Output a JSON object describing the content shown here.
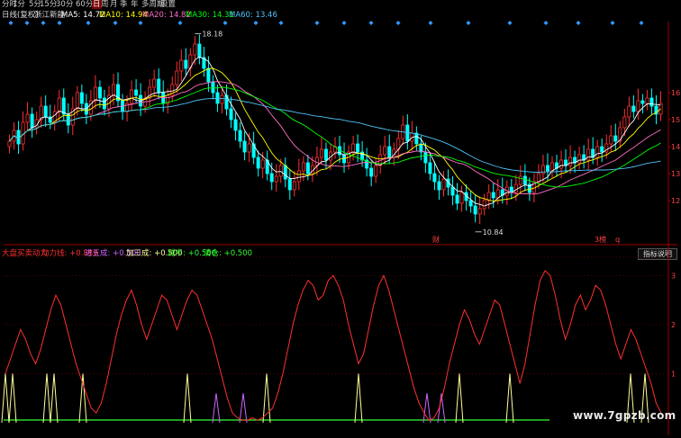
{
  "toolbar": {
    "items": [
      "分时",
      "1分",
      "5分",
      "15分",
      "30分",
      "60分",
      "日",
      "周",
      "月",
      "季",
      "年",
      "多周期",
      "设置"
    ],
    "active": "日"
  },
  "main_legend": {
    "period": "日线(复权)",
    "stock": "浙江新能",
    "ma": [
      {
        "label": "MA5:",
        "value": "14.72",
        "color": "#ffffff"
      },
      {
        "label": "MA10:",
        "value": "14.94",
        "color": "#ffff00"
      },
      {
        "label": "MA20:",
        "value": "14.82",
        "color": "#ff6ec7"
      },
      {
        "label": "MA30:",
        "value": "14.31",
        "color": "#00ff00"
      },
      {
        "label": "MA60:",
        "value": "13.46",
        "color": "#4fc3f7"
      }
    ]
  },
  "annotations": {
    "high": "18.18",
    "low": "10.84",
    "marker_cai": "财",
    "marker_right": "3榜",
    "marker_q": "q"
  },
  "ind_legend": {
    "items": [
      {
        "text": "大盘买卖动力",
        "color": "#ff3030"
      },
      {
        "text": "动力线: +0.889",
        "color": "#ff3030"
      },
      {
        "text": "进五成: +0.500",
        "color": "#cc66ff"
      },
      {
        "text": "加三成: +0.500",
        "color": "#ffff99"
      },
      {
        "text": "减半: +0.500",
        "color": "#33ff33"
      },
      {
        "text": "清仓: +0.500",
        "color": "#33ff33"
      }
    ],
    "help_button": "指标说明"
  },
  "watermark": "www.7gpzb.com",
  "colors": {
    "up": "#ff3030",
    "down": "#00ffff",
    "ma5": "#ffffff",
    "ma10": "#ffff00",
    "ma20": "#ff6ec7",
    "ma30": "#00ff00",
    "ma60": "#4fc3f7",
    "power": "#ff3030",
    "spike_yellow": "#ffff99",
    "spike_purple": "#cc66ff",
    "base_green": "#33ff33",
    "grid": "#8b0000",
    "diamond": "#3399ff"
  },
  "chart_data": [
    {
      "type": "candlestick",
      "title": "",
      "ylim": [
        10.5,
        18.5
      ],
      "y_ticks": [
        "16",
        "15",
        "14",
        "13",
        "12"
      ],
      "high_label": "18.18",
      "low_label": "10.84",
      "close": [
        14.2,
        14.6,
        14.1,
        14.9,
        15.2,
        14.7,
        15.0,
        15.5,
        15.1,
        14.9,
        15.3,
        15.8,
        15.2,
        14.8,
        15.4,
        16.0,
        15.6,
        15.2,
        15.7,
        16.2,
        15.8,
        15.4,
        15.9,
        16.3,
        15.7,
        15.3,
        15.6,
        16.1,
        15.9,
        15.5,
        15.8,
        16.2,
        16.5,
        16.0,
        15.6,
        15.9,
        16.3,
        16.8,
        17.2,
        16.9,
        17.4,
        17.8,
        17.3,
        16.9,
        16.4,
        16.0,
        15.6,
        15.9,
        15.4,
        15.0,
        14.6,
        14.2,
        13.8,
        14.1,
        13.6,
        13.2,
        13.5,
        13.0,
        12.7,
        12.9,
        13.3,
        12.8,
        12.4,
        12.7,
        13.1,
        13.4,
        13.0,
        13.3,
        13.6,
        13.9,
        13.5,
        13.8,
        14.0,
        13.7,
        13.4,
        13.8,
        14.1,
        13.8,
        13.5,
        13.2,
        12.9,
        13.3,
        13.7,
        14.0,
        13.6,
        13.9,
        14.3,
        14.8,
        14.2,
        14.5,
        14.1,
        13.8,
        13.4,
        13.0,
        12.7,
        12.4,
        12.8,
        12.5,
        12.2,
        11.9,
        12.3,
        12.0,
        11.8,
        11.5,
        11.7,
        12.0,
        12.3,
        12.1,
        12.4,
        12.2,
        12.5,
        12.3,
        12.6,
        12.9,
        12.6,
        12.3,
        12.7,
        13.0,
        13.3,
        13.1,
        13.4,
        13.2,
        13.5,
        13.3,
        13.6,
        13.4,
        13.7,
        13.5,
        13.9,
        13.6,
        14.0,
        13.8,
        14.1,
        14.4,
        14.2,
        14.7,
        15.1,
        15.5,
        15.3,
        15.7,
        15.6,
        15.8,
        15.5,
        15.2,
        15.6
      ],
      "open": [
        14.0,
        14.2,
        14.6,
        14.1,
        14.9,
        15.2,
        14.7,
        15.0,
        15.5,
        15.1,
        14.9,
        15.3,
        15.8,
        15.2,
        14.8,
        15.4,
        16.0,
        15.6,
        15.2,
        15.7,
        16.2,
        15.8,
        15.4,
        15.9,
        16.3,
        15.7,
        15.3,
        15.6,
        16.1,
        15.9,
        15.5,
        15.8,
        16.2,
        16.5,
        16.0,
        15.6,
        15.9,
        16.3,
        16.8,
        17.2,
        16.9,
        17.4,
        17.8,
        17.3,
        16.9,
        16.4,
        16.0,
        15.6,
        15.9,
        15.4,
        15.0,
        14.6,
        14.2,
        13.8,
        14.1,
        13.6,
        13.2,
        13.5,
        13.0,
        12.7,
        12.9,
        13.3,
        12.8,
        12.4,
        12.7,
        13.1,
        13.4,
        13.0,
        13.3,
        13.6,
        13.9,
        13.5,
        13.8,
        14.0,
        13.7,
        13.4,
        13.8,
        14.1,
        13.8,
        13.5,
        13.2,
        12.9,
        13.3,
        13.7,
        14.0,
        13.6,
        13.9,
        14.3,
        14.8,
        14.2,
        14.5,
        14.1,
        13.8,
        13.4,
        13.0,
        12.7,
        12.4,
        12.8,
        12.5,
        12.2,
        11.9,
        12.3,
        12.0,
        11.8,
        11.5,
        11.7,
        12.0,
        12.3,
        12.1,
        12.4,
        12.2,
        12.5,
        12.3,
        12.6,
        12.9,
        12.6,
        12.3,
        12.7,
        13.0,
        13.3,
        13.1,
        13.4,
        13.2,
        13.5,
        13.3,
        13.6,
        13.4,
        13.7,
        13.5,
        13.9,
        13.6,
        14.0,
        13.8,
        14.1,
        14.4,
        14.2,
        14.7,
        15.1,
        15.5,
        15.3,
        15.7,
        15.6,
        15.8,
        15.5,
        15.2
      ]
    },
    {
      "type": "line",
      "name": "动力线",
      "ylim": [
        0,
        3.3
      ],
      "y_ticks": [
        "3",
        "2",
        "1"
      ],
      "values": [
        1.0,
        1.3,
        1.6,
        1.9,
        1.7,
        1.4,
        1.2,
        1.5,
        1.9,
        2.3,
        2.6,
        2.4,
        2.0,
        1.6,
        1.2,
        0.9,
        0.6,
        0.3,
        0.2,
        0.4,
        0.8,
        1.3,
        1.8,
        2.2,
        2.5,
        2.7,
        2.4,
        2.0,
        1.7,
        2.0,
        2.3,
        2.6,
        2.5,
        2.2,
        1.9,
        2.2,
        2.5,
        2.7,
        2.6,
        2.3,
        2.0,
        1.7,
        1.3,
        0.9,
        0.5,
        0.2,
        0.1,
        0.05,
        0.05,
        0.1,
        0.05,
        0.1,
        0.2,
        0.3,
        0.6,
        1.0,
        1.5,
        2.0,
        2.4,
        2.7,
        2.9,
        2.8,
        2.5,
        2.6,
        2.9,
        3.0,
        2.8,
        2.5,
        2.0,
        1.6,
        1.2,
        1.4,
        1.9,
        2.4,
        2.8,
        3.0,
        2.7,
        2.3,
        1.9,
        1.5,
        1.1,
        0.7,
        0.4,
        0.2,
        0.05,
        0.1,
        0.3,
        0.7,
        1.2,
        1.6,
        2.0,
        2.3,
        2.1,
        1.8,
        1.6,
        1.9,
        2.2,
        2.5,
        2.4,
        2.0,
        1.6,
        1.2,
        0.8,
        1.2,
        1.8,
        2.4,
        2.9,
        3.1,
        3.0,
        2.6,
        2.1,
        1.7,
        2.0,
        2.4,
        2.6,
        2.3,
        2.5,
        2.8,
        2.7,
        2.4,
        2.0,
        1.6,
        1.3,
        1.6,
        1.9,
        1.7,
        1.4,
        1.1,
        0.8,
        0.4,
        0.2
      ]
    }
  ]
}
